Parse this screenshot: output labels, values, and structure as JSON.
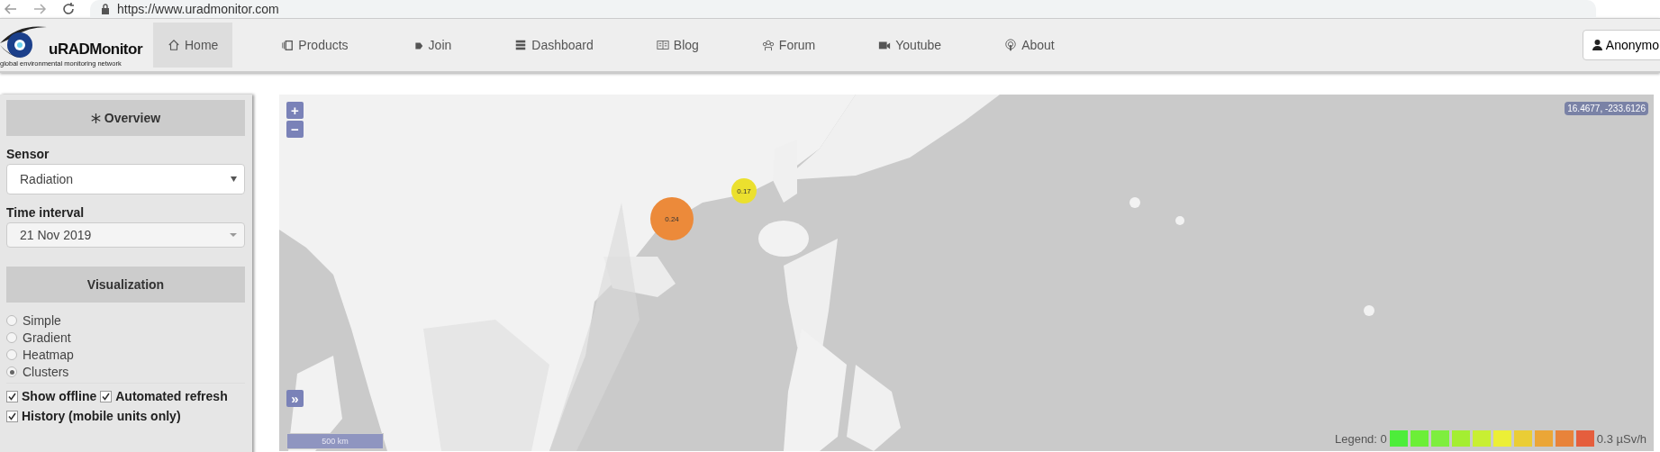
{
  "browser": {
    "url": "https://www.uradmonitor.com"
  },
  "header": {
    "logo_name": "uRADMonitor",
    "logo_tagline": "global environmental monitoring network",
    "nav": [
      {
        "label": "Home",
        "selected": true
      },
      {
        "label": "Products",
        "selected": false
      },
      {
        "label": "Join",
        "selected": false
      },
      {
        "label": "Dashboard",
        "selected": false
      },
      {
        "label": "Blog",
        "selected": false
      },
      {
        "label": "Forum",
        "selected": false
      },
      {
        "label": "Youtube",
        "selected": false
      },
      {
        "label": "About",
        "selected": false
      }
    ],
    "user_button": "Anonymo"
  },
  "sidebar": {
    "overview_heading": "Overview",
    "sensor_label": "Sensor",
    "sensor_select": "Radiation",
    "time_label": "Time interval",
    "time_select": "21 Nov 2019",
    "visualization_heading": "Visualization",
    "radios": [
      {
        "label": "Simple",
        "selected": false
      },
      {
        "label": "Gradient",
        "selected": false
      },
      {
        "label": "Heatmap",
        "selected": false
      },
      {
        "label": "Clusters",
        "selected": true
      }
    ],
    "checkboxes": [
      {
        "label": "Show offline",
        "checked": true
      },
      {
        "label": "Automated refresh",
        "checked": true
      },
      {
        "label": "History (mobile units only)",
        "checked": true
      }
    ]
  },
  "map": {
    "kind": "picture",
    "zoom_in": "+",
    "zoom_out": "−",
    "expand": "»",
    "scale": "500 km",
    "coordinates": "16.4677, -233.6126",
    "clusters": [
      {
        "label": "0.24",
        "color": "#ec8a3a"
      },
      {
        "label": "0.17",
        "color": "#ebe02e"
      }
    ],
    "legend": {
      "start_label": "Legend: 0",
      "end_label": "0.3 µSv/h",
      "swatches": [
        {
          "color": "#4ded3a"
        },
        {
          "color": "#6cef37"
        },
        {
          "color": "#7eee3e"
        },
        {
          "color": "#a4ee31"
        },
        {
          "color": "#c8ef32"
        },
        {
          "color": "#ecef36"
        },
        {
          "color": "#eacd35"
        },
        {
          "color": "#eba637"
        },
        {
          "color": "#e8833a"
        },
        {
          "color": "#e55e3d"
        }
      ]
    }
  }
}
